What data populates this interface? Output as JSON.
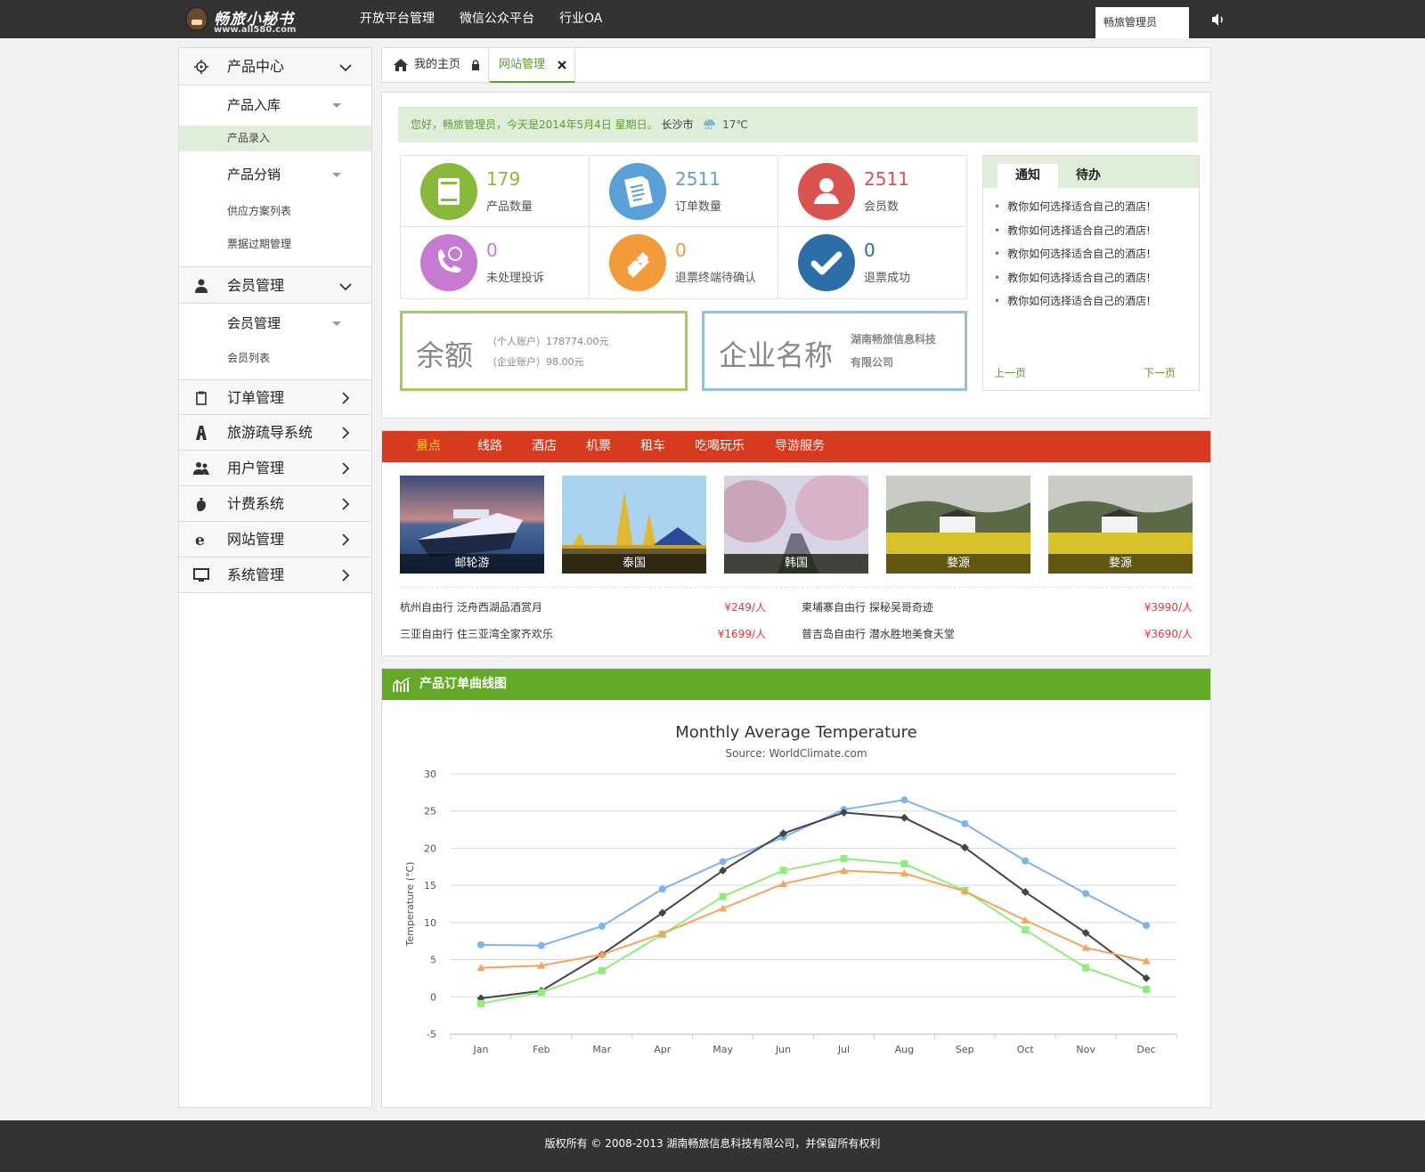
{
  "topbar": {
    "logo_brand": "畅旅小秘书",
    "logo_url": "www.all580.com",
    "nav": [
      "开放平台管理",
      "微信公众平台",
      "行业OA"
    ],
    "username": "畅旅管理员"
  },
  "sidebar": {
    "product_center": "产品中心",
    "product_storage": "产品入库",
    "product_entry": "产品录入",
    "product_distribution": "产品分销",
    "supply_plan_list": "供应方案列表",
    "ticket_expiry": "票据过期管理",
    "member_mgmt": "会员管理",
    "member_mgmt_sub": "会员管理",
    "member_list": "会员列表",
    "order_mgmt": "订单管理",
    "tour_guide": "旅游疏导系统",
    "user_mgmt": "用户管理",
    "billing": "计费系统",
    "site_mgmt": "网站管理",
    "system_mgmt": "系统管理"
  },
  "tabs": {
    "home": "我的主页",
    "site": "网站管理"
  },
  "greeting": {
    "text": "您好，畅旅管理员，今天是2014年5月4日  星期日。",
    "city": "长沙市",
    "temp": "17℃"
  },
  "stats": [
    {
      "value": "179",
      "label": "产品数量",
      "color": "#8ab83b"
    },
    {
      "value": "2511",
      "label": "订单数量",
      "color": "#5aa0d6"
    },
    {
      "value": "2511",
      "label": "会员数",
      "color": "#d9534f"
    },
    {
      "value": "0",
      "label": "未处理投诉",
      "color": "#c77bd0"
    },
    {
      "value": "0",
      "label": "退票终端待确认",
      "color": "#f39a3a"
    },
    {
      "value": "0",
      "label": "退票成功",
      "color": "#2b6ea8"
    }
  ],
  "balance": {
    "title": "余额",
    "personal": "（个人账户）178774.00元",
    "company": "（企业账户）98.00元"
  },
  "company": {
    "title": "企业名称",
    "name_line1": "湖南畅旅信息科技",
    "name_line2": "有限公司"
  },
  "notice": {
    "tab_notice": "通知",
    "tab_todo": "待办",
    "items": [
      "教你如何选择适合自己的酒店!",
      "教你如何选择适合自己的酒店!",
      "教你如何选择适合自己的酒店!",
      "教你如何选择适合自己的酒店!",
      "教你如何选择适合自己的酒店!"
    ],
    "prev": "上一页",
    "next": "下一页"
  },
  "travel": {
    "tabs": [
      "景点",
      "线路",
      "酒店",
      "机票",
      "租车",
      "吃喝玩乐",
      "导游服务"
    ],
    "pics": [
      "邮轮游",
      "泰国",
      "韩国",
      "婺源",
      "婺源"
    ],
    "deals": [
      {
        "title": "杭州自由行 泛舟西湖品酒赏月",
        "price": "¥249/人"
      },
      {
        "title": "柬埔寨自由行 探秘吴哥奇迹",
        "price": "¥3990/人"
      },
      {
        "title": "三亚自由行 住三亚湾全家齐欢乐",
        "price": "¥1699/人"
      },
      {
        "title": "普吉岛自由行 潜水胜地美食天堂",
        "price": "¥3690/人"
      }
    ]
  },
  "chart_panel": {
    "title": "产品订单曲线图"
  },
  "chart_data": {
    "type": "line",
    "title": "Monthly Average Temperature",
    "subtitle": "Source: WorldClimate.com",
    "ylabel": "Temperature (°C)",
    "categories": [
      "Jan",
      "Feb",
      "Mar",
      "Apr",
      "May",
      "Jun",
      "Jul",
      "Aug",
      "Sep",
      "Oct",
      "Nov",
      "Dec"
    ],
    "ylim": [
      -5,
      30
    ],
    "yticks": [
      -5,
      0,
      5,
      10,
      15,
      20,
      25,
      30
    ],
    "grid": true,
    "series": [
      {
        "color": "#7cb5ec",
        "marker": "circle",
        "values": [
          7.0,
          6.9,
          9.5,
          14.5,
          18.2,
          21.5,
          25.2,
          26.5,
          23.3,
          18.3,
          13.9,
          9.6
        ]
      },
      {
        "color": "#434348",
        "marker": "diamond",
        "values": [
          -0.2,
          0.8,
          5.7,
          11.3,
          17.0,
          22.0,
          24.8,
          24.1,
          20.1,
          14.1,
          8.6,
          2.5
        ]
      },
      {
        "color": "#90ed7d",
        "marker": "square",
        "values": [
          -0.9,
          0.6,
          3.5,
          8.4,
          13.5,
          17.0,
          18.6,
          17.9,
          14.3,
          9.0,
          3.9,
          1.0
        ]
      },
      {
        "color": "#f7a35c",
        "marker": "triangle",
        "values": [
          3.9,
          4.2,
          5.7,
          8.5,
          11.9,
          15.2,
          17.0,
          16.6,
          14.2,
          10.3,
          6.6,
          4.8
        ]
      }
    ]
  },
  "footer": {
    "text": "版权所有 © 2008-2013 湖南畅旅信息科技有限公司，并保留所有权利"
  }
}
